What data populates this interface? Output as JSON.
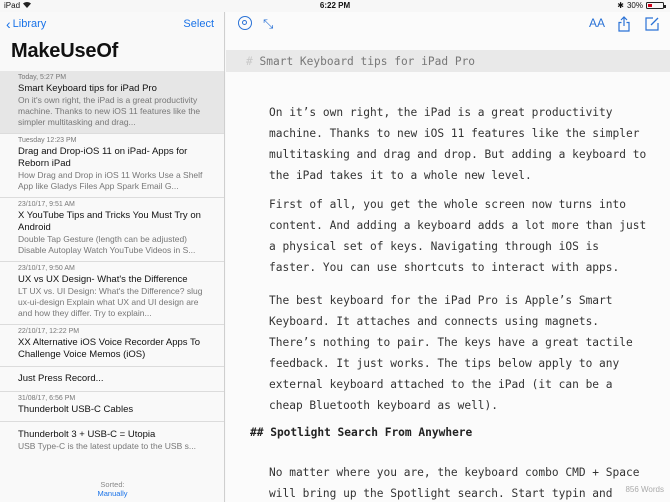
{
  "status": {
    "device": "iPad",
    "time": "6:22 PM",
    "battery": "30%",
    "battery_level": 0.3
  },
  "sidebar": {
    "back_label": "Library",
    "select_label": "Select",
    "title": "MakeUseOf",
    "items": [
      {
        "date": "Today, 5:27 PM",
        "title": "Smart Keyboard tips for iPad Pro",
        "preview": "On it's own right, the iPad is a great productivity machine. Thanks to new iOS 11 features like the simpler multitasking and drag..."
      },
      {
        "date": "Tuesday 12:23 PM",
        "title": "Drag and Drop-iOS 11 on iPad- Apps for Reborn iPad",
        "preview": "How Drag and Drop in iOS 11 Works Use a Shelf App like Gladys Files App Spark Email G..."
      },
      {
        "date": "23/10/17, 9:51 AM",
        "title": "X YouTube Tips and Tricks You Must Try on Android",
        "preview": "Double Tap Gesture (length can be adjusted) Disable Autoplay Watch YouTube Videos in S..."
      },
      {
        "date": "23/10/17, 9:50 AM",
        "title": "UX vs UX Design- What's the Difference",
        "preview": "LT UX vs. UI Design: What's the Difference? slug ux-ui-design Explain what UX and UI design are and how they differ. Try to explain..."
      },
      {
        "date": "22/10/17, 12:22 PM",
        "title": "XX Alternative iOS Voice Recorder Apps To Challenge Voice Memos (iOS)",
        "preview": ""
      },
      {
        "date": "",
        "title": "Just Press Record...",
        "preview": ""
      },
      {
        "date": "31/08/17, 6:56 PM",
        "title": "Thunderbolt USB-C Cables",
        "preview": ""
      },
      {
        "date": "",
        "title": "Thunderbolt 3 + USB-C = Utopia",
        "preview": "USB Type-C is the latest update to the USB s..."
      }
    ],
    "sorted_label": "Sorted:",
    "sorted_value": "Manually"
  },
  "toolbar": {
    "icons": [
      "search-icon",
      "expand-icon",
      "font-size-icon",
      "share-icon",
      "compose-icon"
    ],
    "font_glyph": "AA"
  },
  "document": {
    "heading_mark": "#",
    "heading": "Smart Keyboard tips for iPad Pro",
    "paragraphs": [
      "On it’s own right, the iPad is a great productivity machine. Thanks to new iOS 11 features like the simpler multitasking and drag and drop. But adding a keyboard to the iPad takes it to a whole new level.",
      "First of all, you get the whole screen now turns into content. And adding a keyboard adds a lot more than just a physical set of keys. Navigating through iOS is faster. You can use shortcuts to interact with apps.",
      "The best keyboard for the iPad Pro is Apple’s Smart Keyboard. It attaches and connects using magnets. There’s nothing to pair. The keys have a great tactile feedback. It just works. The tips below apply to any external keyboard attached to the iPad (it can be a cheap Bluetooth keyboard as well).",
      "No matter where you are, the keyboard combo CMD + Space will bring up the Spotlight search. Start typin and you’ll start seeing results."
    ],
    "subheading": "## Spotlight Search From Anywhere",
    "word_count": "856 Words"
  },
  "colors": {
    "accent": "#1a73e8",
    "battery_low": "#d0021b",
    "selected_row": "#e6e6e6"
  }
}
